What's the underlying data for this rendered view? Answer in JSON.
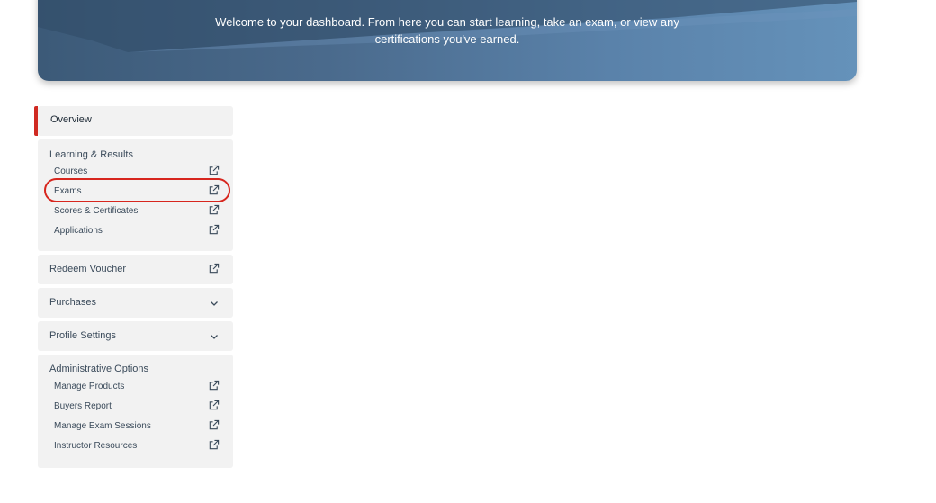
{
  "hero": {
    "welcome_line1": "Welcome to your dashboard. From here you can start learning, take an exam, or view any",
    "welcome_line2": "certifications you've earned."
  },
  "sidebar": {
    "overview_label": "Overview",
    "learning": {
      "title": "Learning & Results",
      "items": [
        {
          "label": "Courses",
          "icon": "external-link-icon"
        },
        {
          "label": "Exams",
          "icon": "external-link-icon"
        },
        {
          "label": "Scores & Certificates",
          "icon": "external-link-icon"
        },
        {
          "label": "Applications",
          "icon": "external-link-icon"
        }
      ]
    },
    "redeem_voucher": {
      "label": "Redeem Voucher",
      "icon": "external-link-icon"
    },
    "purchases": {
      "label": "Purchases",
      "icon": "chevron-down-icon"
    },
    "profile_settings": {
      "label": "Profile Settings",
      "icon": "chevron-down-icon"
    },
    "admin": {
      "title": "Administrative Options",
      "items": [
        {
          "label": "Manage Products",
          "icon": "external-link-icon"
        },
        {
          "label": "Buyers Report",
          "icon": "external-link-icon"
        },
        {
          "label": "Manage Exam Sessions",
          "icon": "external-link-icon"
        },
        {
          "label": "Instructor Resources",
          "icon": "external-link-icon"
        }
      ]
    }
  },
  "colors": {
    "accent": "#d02a22",
    "hero_gradient_start": "#3c5a78",
    "hero_gradient_end": "#6592ba",
    "panel_bg": "#f2f2f2"
  }
}
